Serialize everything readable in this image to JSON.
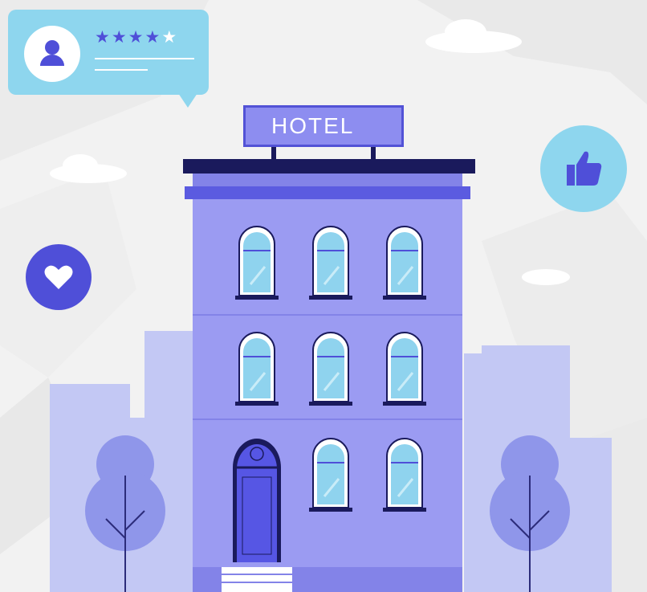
{
  "sign": {
    "text": "HOTEL"
  },
  "review": {
    "rating": 4,
    "max_rating": 5,
    "stars": [
      "★",
      "★",
      "★",
      "★",
      "★"
    ]
  },
  "icons": {
    "avatar": "user-icon",
    "like": "thumbs-up-icon",
    "favorite": "heart-icon"
  },
  "colors": {
    "background": "#f2f2f2",
    "building": "#9b9bf2",
    "building_dark": "#8383e8",
    "accent": "#4f4fd8",
    "roof": "#1a1a5c",
    "window_glass": "#8fd3ee",
    "skyline": "#c3c8f4",
    "tree": "#8f96ea",
    "bubble": "#8ed6ee"
  }
}
